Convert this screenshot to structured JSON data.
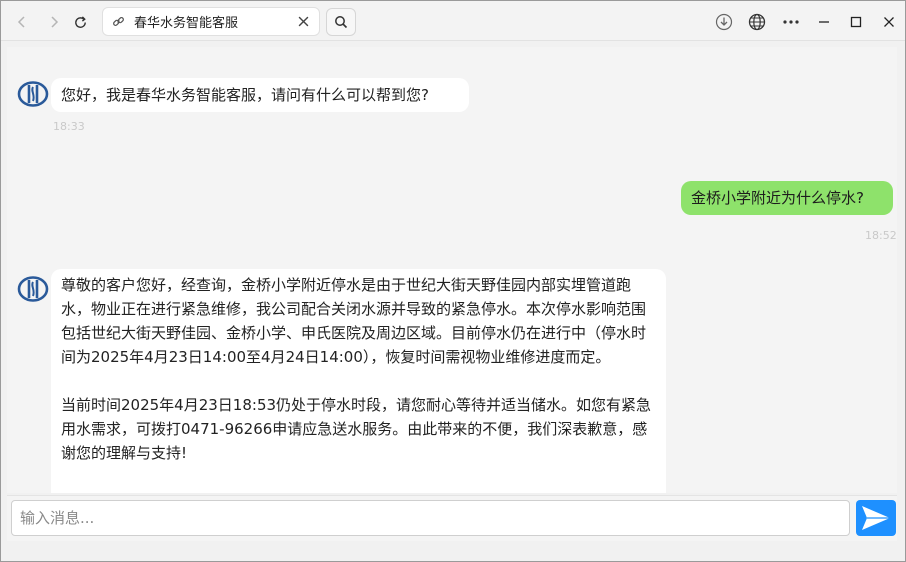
{
  "browser": {
    "tab_title": "春华水务智能客服",
    "icons": [
      "back-arrow-icon",
      "forward-arrow-icon",
      "reload-icon",
      "link-icon",
      "close-icon",
      "search-icon",
      "download-icon",
      "globe-icon",
      "more-icon",
      "minimize-icon",
      "maximize-icon",
      "window-close-icon"
    ]
  },
  "chat": {
    "messages": [
      {
        "role": "bot",
        "text": "您好，我是春华水务智能客服，请问有什么可以帮到您?",
        "time": "18:33"
      },
      {
        "role": "user",
        "text": "金桥小学附近为什么停水?",
        "time": "18:52"
      },
      {
        "role": "bot",
        "paragraphs": [
          "尊敬的客户您好，经查询，金桥小学附近停水是由于世纪大街天野佳园内部实埋管道跑水，物业正在进行紧急维修，我公司配合关闭水源并导致的紧急停水。本次停水影响范围包括世纪大街天野佳园、金桥小学、申氏医院及周边区域。目前停水仍在进行中（停水时间为2025年4月23日14:00至4月24日14:00），恢复时间需视物业维修进度而定。",
          "当前时间2025年4月23日18:53仍处于停水时段，请您耐心等待并适当储水。如您有紧急用水需求，可拨打0471-96266申请应急送水服务。由此带来的不便，我们深表歉意，感谢您的理解与支持!"
        ]
      }
    ]
  },
  "input": {
    "placeholder": "输入消息...",
    "value": ""
  },
  "colors": {
    "user_bubble": "#8ee26b",
    "bot_bubble": "#ffffff",
    "send_button": "#1e90ff",
    "avatar": "#2a5a9a"
  }
}
